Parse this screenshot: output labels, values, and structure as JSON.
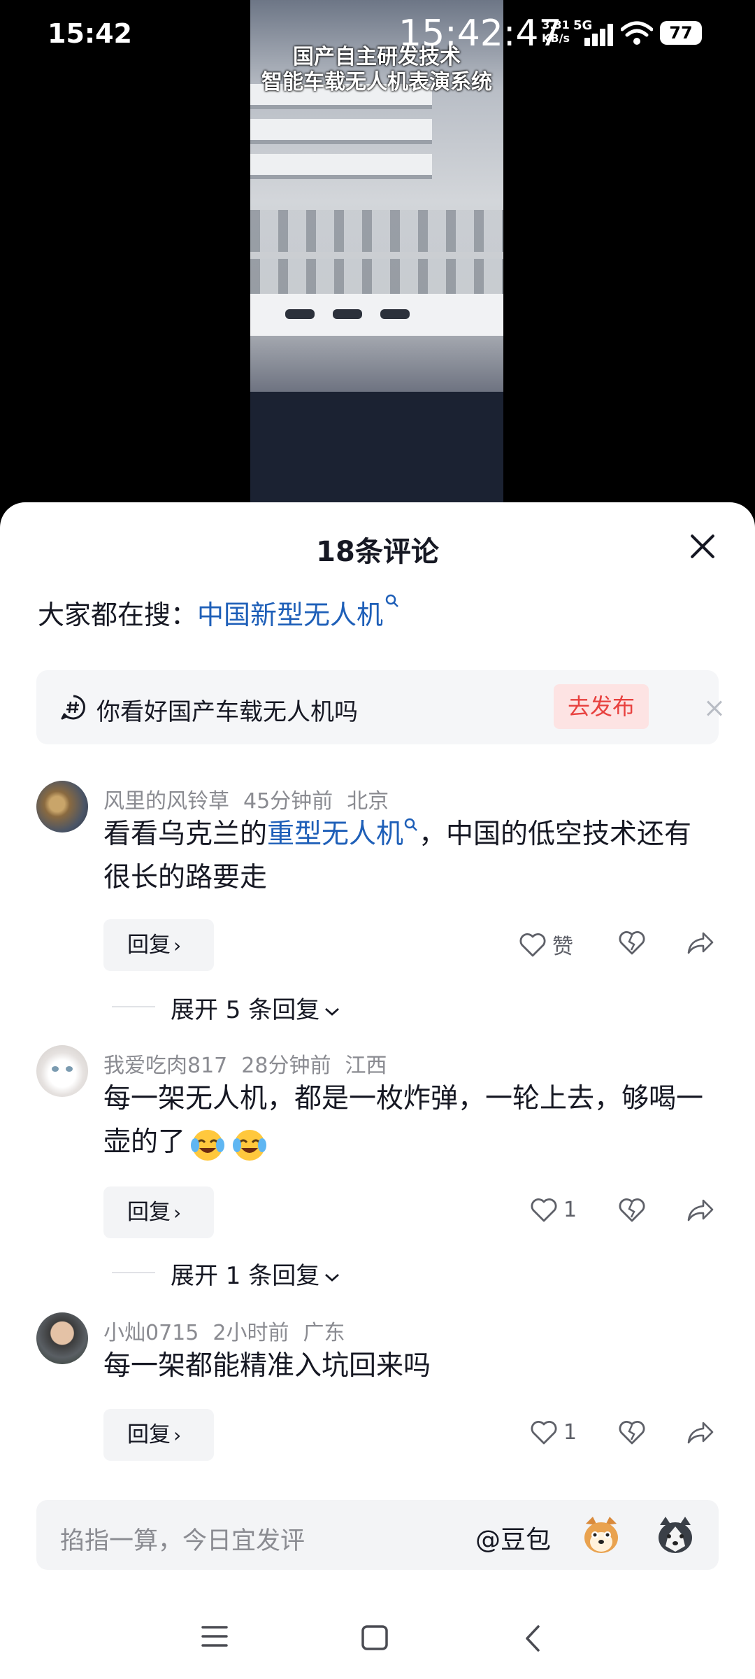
{
  "status_bar": {
    "time": "15:42",
    "clock_overlay": "15:42:47",
    "net_speed_value": "3.31",
    "net_speed_unit": "KB/s",
    "network": "5G",
    "battery": "77"
  },
  "video": {
    "caption_line1": "国产自主研发技术",
    "caption_line2": "智能车载无人机表演系统"
  },
  "comments_panel": {
    "title": "18条评论",
    "hot_search_label": "大家都在搜：",
    "hot_search_link": "中国新型无人机",
    "topic_prompt": "你看好国产车载无人机吗",
    "topic_button": "去发布",
    "comments": [
      {
        "user": "风里的风铃草",
        "time": "45分钟前",
        "location": "北京",
        "text_before": "看看乌克兰的",
        "text_link": "重型无人机",
        "text_after": "，中国的低空技术还有很长的路要走",
        "like_label": "赞",
        "reply_label": "回复",
        "expand_label": "展开 5 条回复"
      },
      {
        "user": "我爱吃肉817",
        "time": "28分钟前",
        "location": "江西",
        "text": "每一架无人机，都是一枚炸弹，一轮上去，够喝一壶的了",
        "emojis": [
          "laughing-crying-emoji",
          "laughing-crying-emoji"
        ],
        "like_count": "1",
        "reply_label": "回复",
        "expand_label": "展开 1 条回复"
      },
      {
        "user": "小灿0715",
        "time": "2小时前",
        "location": "广东",
        "text": "每一架都能精准入坑回来吗",
        "like_count": "1",
        "reply_label": "回复"
      }
    ]
  },
  "input_bar": {
    "placeholder": "掐指一算，今日宜发评",
    "at_label": "@豆包"
  },
  "icons": {
    "close": "close-icon",
    "topic": "hashtag-chat-icon",
    "search": "search-small-icon",
    "like": "heart-icon",
    "dislike": "broken-heart-icon",
    "share": "share-arrow-icon",
    "nav": [
      "menu-icon",
      "home-square-icon",
      "back-chevron-icon"
    ]
  },
  "colors": {
    "link": "#1e5fb8",
    "accent_red": "#e8413f",
    "muted_text": "#8a8b91"
  }
}
